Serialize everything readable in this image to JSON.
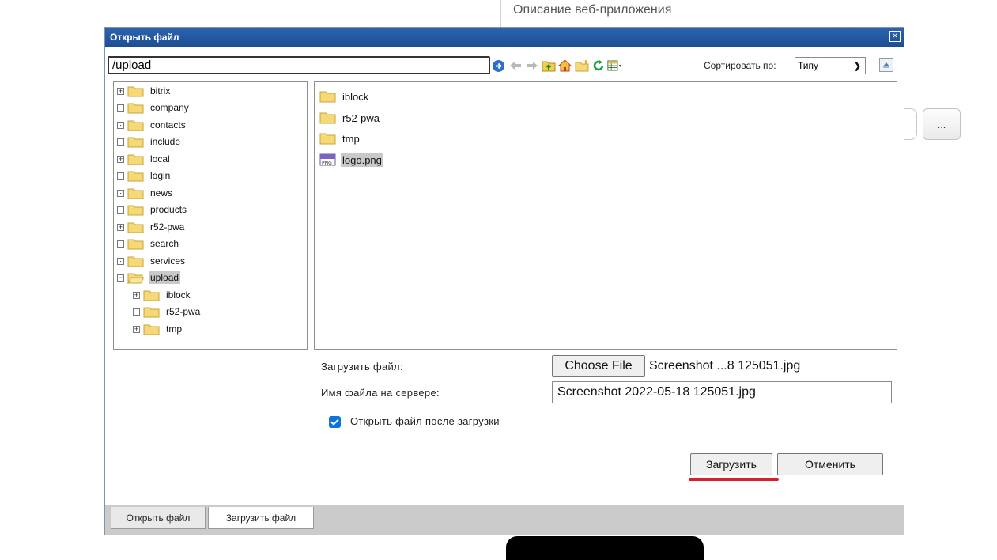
{
  "background": {
    "description_text": "Описание веб-приложения",
    "dots_button_label": "..."
  },
  "dialog": {
    "title": "Открыть файл",
    "close_label": "×",
    "path_value": "/upload",
    "sort_label": "Сортировать по:",
    "sort_value": "Типу"
  },
  "tree": {
    "items": [
      {
        "label": "bitrix",
        "toggle": "+"
      },
      {
        "label": "company",
        "toggle": "·"
      },
      {
        "label": "contacts",
        "toggle": "·"
      },
      {
        "label": "include",
        "toggle": "·"
      },
      {
        "label": "local",
        "toggle": "+"
      },
      {
        "label": "login",
        "toggle": "·"
      },
      {
        "label": "news",
        "toggle": "·"
      },
      {
        "label": "products",
        "toggle": "·"
      },
      {
        "label": "r52-pwa",
        "toggle": "+"
      },
      {
        "label": "search",
        "toggle": "·"
      },
      {
        "label": "services",
        "toggle": "·"
      },
      {
        "label": "upload",
        "toggle": "−"
      }
    ],
    "children": [
      {
        "label": "iblock",
        "toggle": "+"
      },
      {
        "label": "r52-pwa",
        "toggle": "·"
      },
      {
        "label": "tmp",
        "toggle": "+"
      }
    ]
  },
  "files": {
    "items": [
      {
        "label": "iblock",
        "kind": "folder"
      },
      {
        "label": "r52-pwa",
        "kind": "folder"
      },
      {
        "label": "tmp",
        "kind": "folder"
      },
      {
        "label": "logo.png",
        "kind": "png"
      }
    ]
  },
  "upload_form": {
    "upload_label": "Загрузить файл:",
    "choose_button": "Choose File",
    "chosen_file": "Screenshot ...8 125051.jpg",
    "server_name_label": "Имя файла на сервере:",
    "server_name_value": "Screenshot 2022-05-18 125051.jpg",
    "open_after_label": "Открыть файл после загрузки",
    "open_after_checked": true,
    "upload_button": "Загрузить",
    "cancel_button": "Отменить"
  },
  "tabs": {
    "open": "Открыть файл",
    "upload": "Загрузить файл"
  },
  "colors": {
    "titlebar": "#1f55a0",
    "accent_red": "#d3202a",
    "checkbox": "#0a74da",
    "folder": "#f6d874"
  }
}
